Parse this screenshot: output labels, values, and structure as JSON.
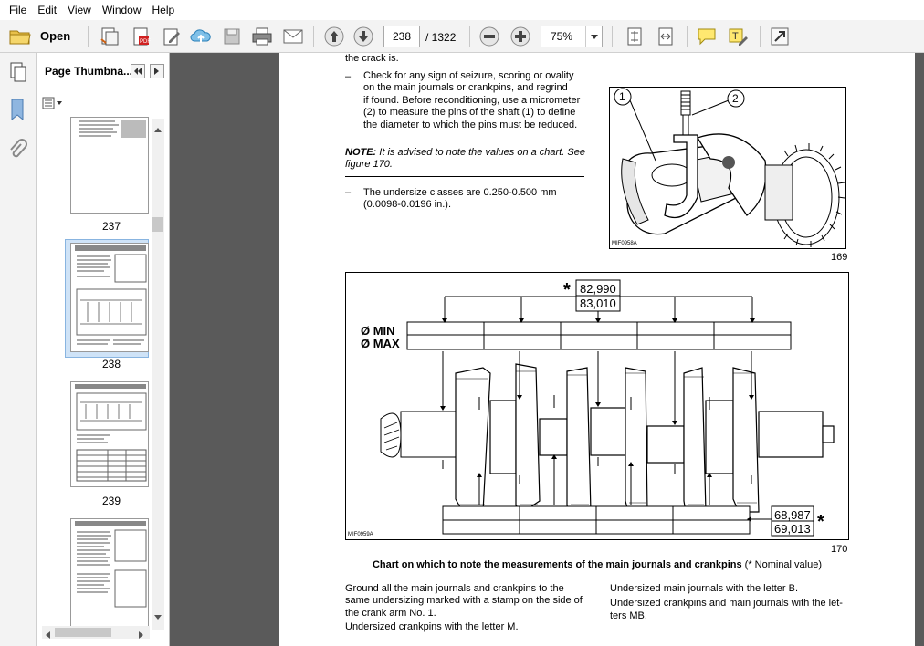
{
  "menu": [
    "File",
    "Edit",
    "View",
    "Window",
    "Help"
  ],
  "toolbar": {
    "open_label": "Open",
    "page_current": "238",
    "page_total": "/ 1322",
    "zoom": "75%"
  },
  "thumbnails": {
    "title": "Page Thumbna...",
    "pages": [
      "237",
      "238",
      "239"
    ]
  },
  "doc": {
    "top_fragment": "the crack is.",
    "bullet1": "Check for any sign of seizure, scoring or ovality on the main journals or crankpins, and regrind if found. Before reconditioning, use a micrometer (2) to measure the pins of the shaft (1) to define the diameter to which the pins must be reduced.",
    "bullet1_lines": [
      "Check for any sign of seizure, scoring or ovality",
      "on the main journals or crankpins, and regrind",
      "if found. Before reconditioning, use a micrometer",
      "(2) to measure the pins of the shaft (1) to define",
      "the diameter to which the pins must be reduced."
    ],
    "note_label": "NOTE:",
    "note_lines": [
      " It is advised to note the values on a chart. See",
      "figure 170."
    ],
    "bullet2_lines": [
      "The undersize classes are 0.250-0.500 mm",
      "(0.0098-0.0196 in.)."
    ],
    "dash": "–",
    "fig169": {
      "code": "MIF0958A",
      "number": "169",
      "callout1": "1",
      "callout2": "2"
    },
    "fig170": {
      "code": "MIF0959A",
      "number": "170",
      "nominal_top": [
        "82,990",
        "83,010"
      ],
      "nominal_bottom": [
        "68,987",
        "69,013"
      ],
      "star": "*",
      "min_label": "Ø MIN",
      "max_label": "Ø MAX"
    },
    "caption_bold": "Chart on which to note the measurements of the main journals and crankpins",
    "caption_rest": " (* Nominal value)",
    "left_col": [
      "Ground all the main journals and crankpins to the",
      "same undersizing marked with a stamp on the side of",
      "the crank arm No. 1.",
      "Undersized crankpins with the letter M."
    ],
    "right_col": [
      "Undersized main journals with the letter B.",
      "Undersized crankpins and main journals with the let-",
      "ters MB."
    ]
  }
}
